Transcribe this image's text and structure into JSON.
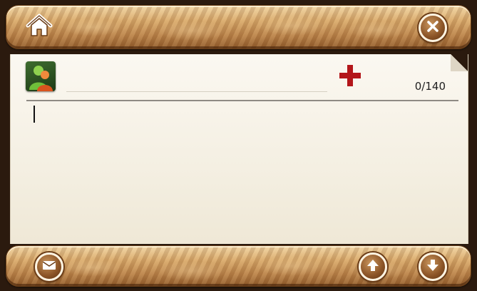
{
  "header": {
    "home_icon": "home-icon",
    "close_icon": "close-icon"
  },
  "compose": {
    "contacts_icon": "contacts-icon",
    "add_icon": "plus-icon",
    "recipient_value": "",
    "message_value": "",
    "char_counter": "0/140"
  },
  "footer": {
    "send_icon": "envelope-icon",
    "up_icon": "arrow-up-icon",
    "down_icon": "arrow-down-icon"
  },
  "colors": {
    "bar_wood": "#c08a52",
    "paper": "#f6f1e6",
    "add_red": "#b3161a",
    "contact_green": "#3e6d2f"
  }
}
